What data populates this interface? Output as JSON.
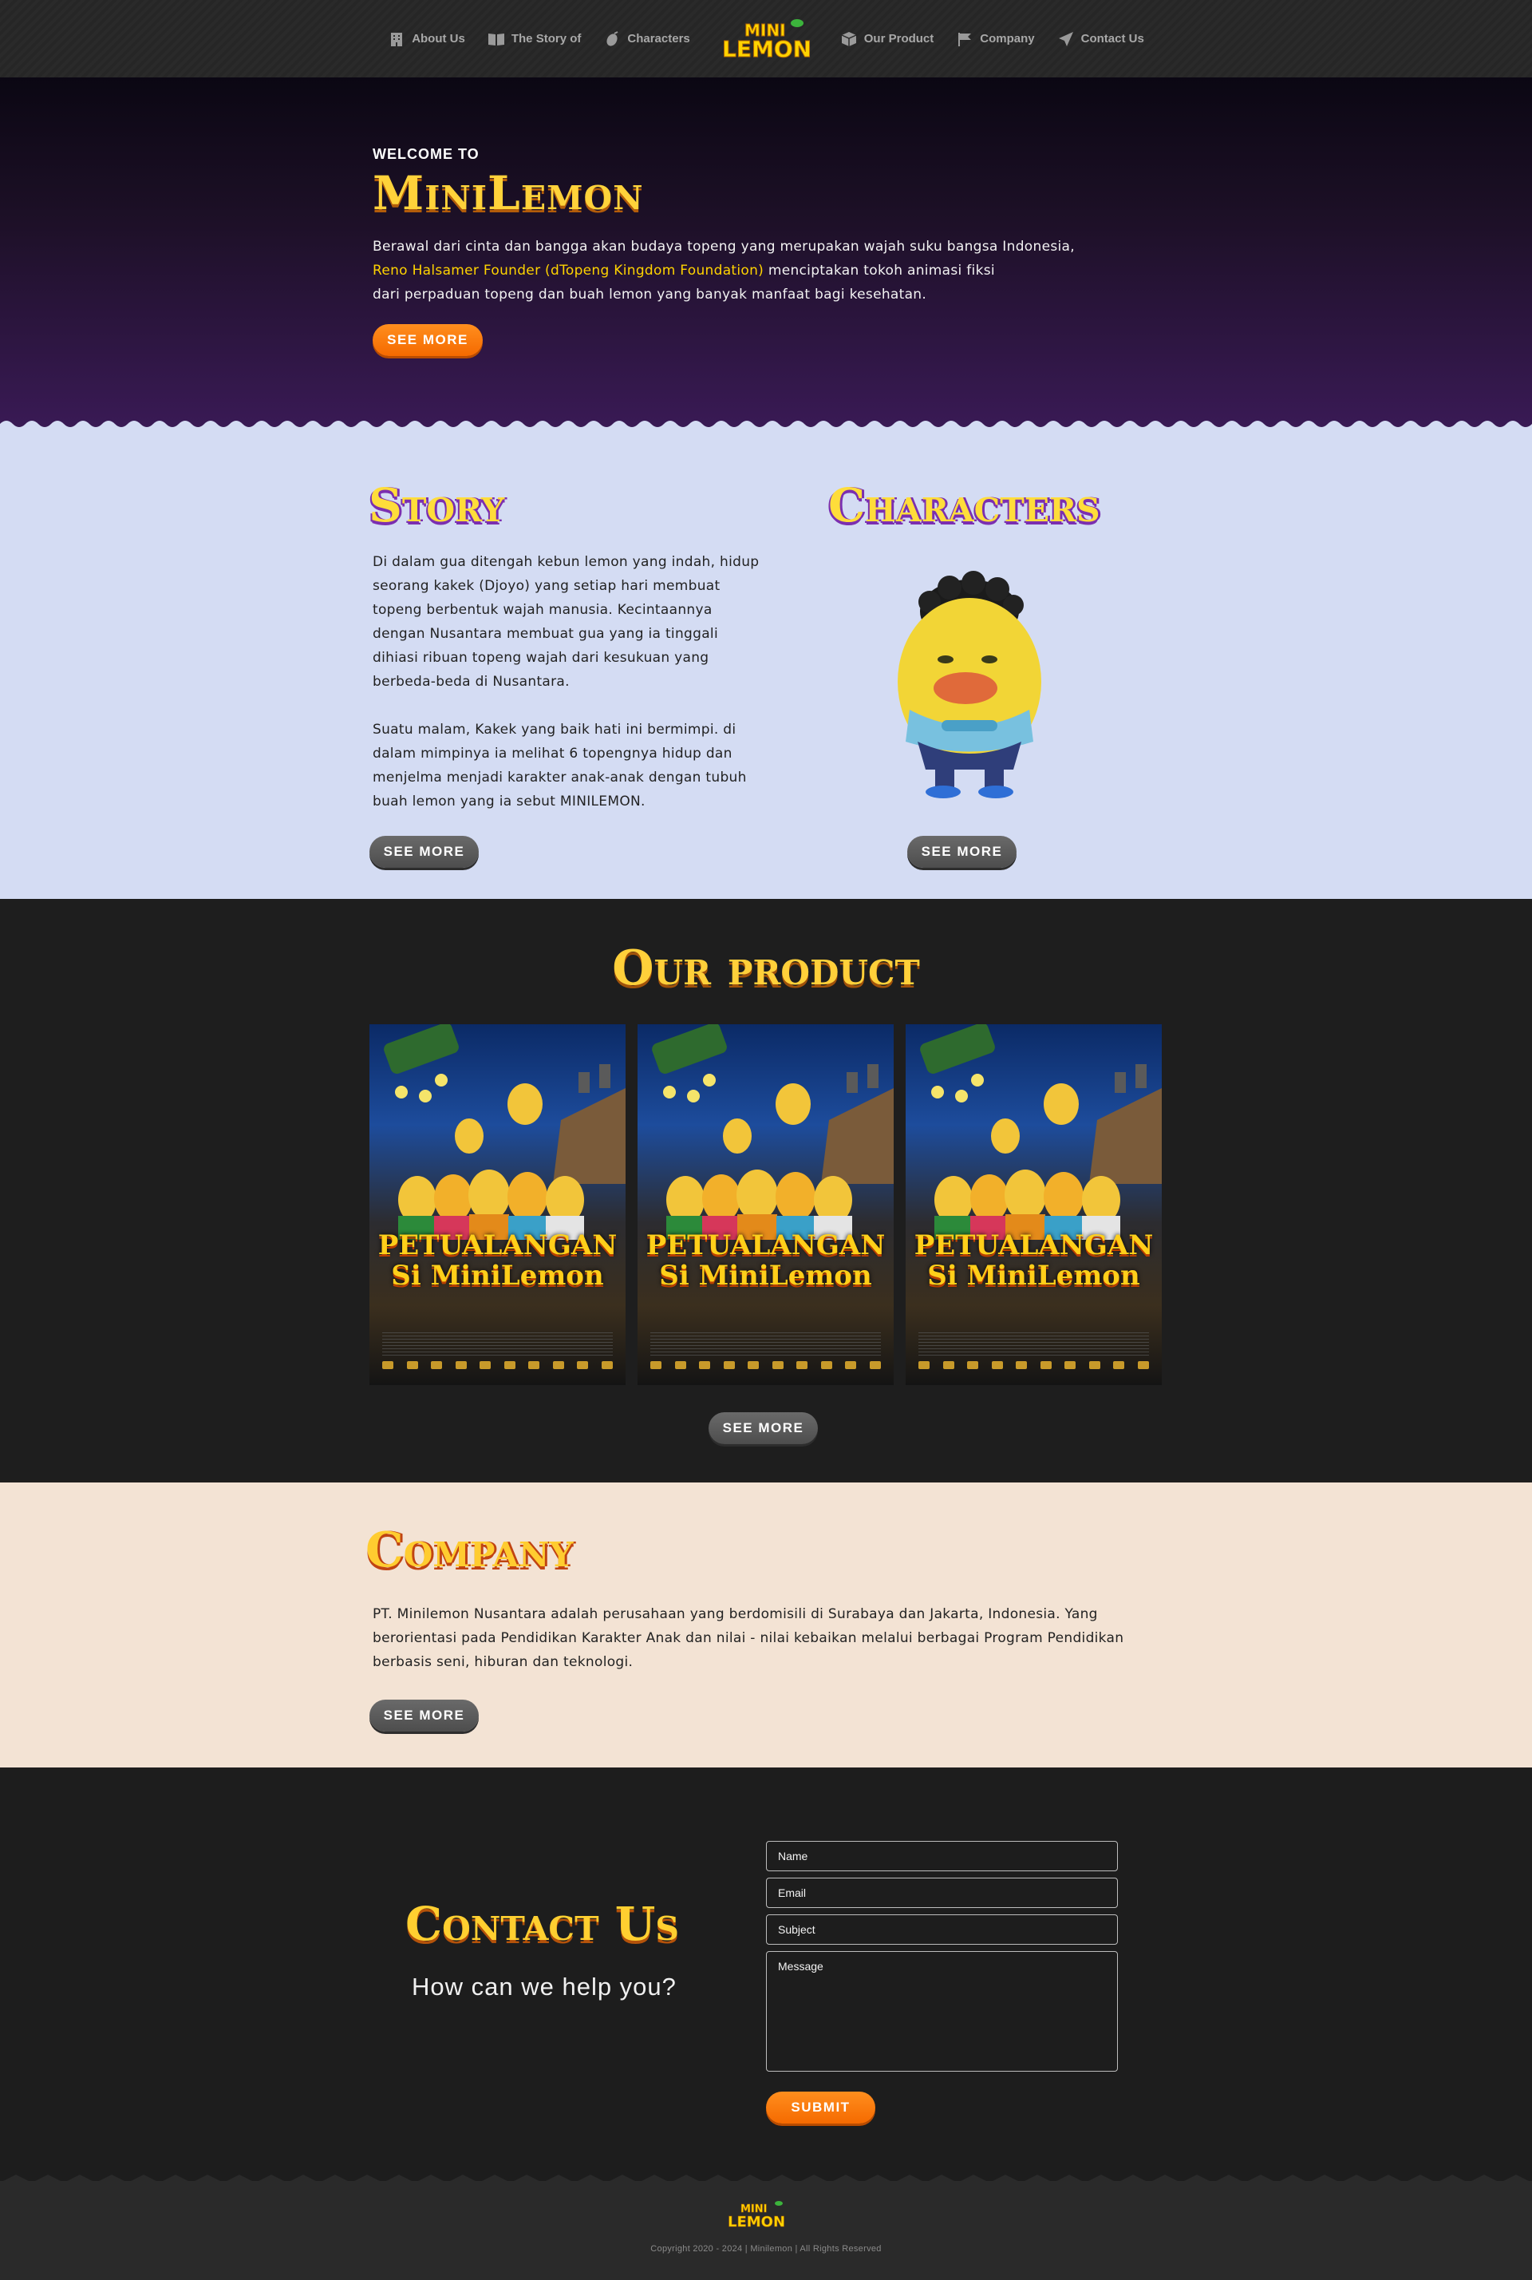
{
  "nav": {
    "left_items": [
      {
        "label": "About Us",
        "icon": "building-icon"
      },
      {
        "label": "The Story of",
        "icon": "book-icon"
      },
      {
        "label": "Characters",
        "icon": "lemon-icon"
      }
    ],
    "logo_text_top": "MINI",
    "logo_text_bottom": "LEMON",
    "right_items": [
      {
        "label": "Our Product",
        "icon": "box-icon"
      },
      {
        "label": "Company",
        "icon": "flag-icon"
      },
      {
        "label": "Contact Us",
        "icon": "paper-plane-icon"
      }
    ]
  },
  "hero": {
    "welcome": "WELCOME TO",
    "title": "MiniLemon",
    "text_line1": "Berawal dari cinta dan bangga akan budaya topeng yang merupakan wajah suku bangsa Indonesia,",
    "text_highlight": "Reno Halsamer Founder (dTopeng Kingdom Foundation)",
    "text_line2_rest": " menciptakan tokoh animasi fiksi",
    "text_line3": "dari perpaduan topeng dan buah lemon yang banyak manfaat bagi kesehatan.",
    "button": "SEE MORE"
  },
  "story": {
    "title": "Story",
    "paragraph1": "Di dalam gua ditengah kebun lemon yang indah, hidup seorang kakek (Djoyo) yang setiap hari membuat topeng berbentuk wajah manusia. Kecintaannya dengan Nusantara membuat gua yang ia tinggali dihiasi ribuan topeng wajah dari kesukuan yang berbeda-beda di Nusantara.",
    "paragraph2": "Suatu malam, Kakek yang baik hati ini bermimpi. di dalam mimpinya ia melihat 6 topengnya hidup dan menjelma menjadi karakter anak-anak dengan tubuh buah lemon yang ia sebut MINILEMON.",
    "button": "SEE MORE"
  },
  "characters": {
    "title": "Characters",
    "button": "SEE MORE"
  },
  "product": {
    "title": "Our product",
    "posters": [
      {
        "line1": "PETUALANGAN",
        "line2": "Si MiniLemon"
      },
      {
        "line1": "PETUALANGAN",
        "line2": "Si MiniLemon"
      },
      {
        "line1": "PETUALANGAN",
        "line2": "Si MiniLemon"
      }
    ],
    "button": "SEE MORE"
  },
  "company": {
    "title": "Company",
    "text": "PT. Minilemon Nusantara adalah perusahaan yang berdomisili di Surabaya dan Jakarta, Indonesia. Yang berorientasi pada Pendidikan Karakter Anak dan nilai - nilai kebaikan melalui berbagai Program Pendidikan berbasis seni, hiburan dan teknologi.",
    "button": "SEE MORE"
  },
  "contact": {
    "title": "Contact Us",
    "subtitle": "How can we help you?",
    "fields": {
      "name": "Name",
      "email": "Email",
      "subject": "Subject",
      "message": "Message"
    },
    "submit": "SUBMIT"
  },
  "footer": {
    "logo_text_top": "MINI",
    "logo_text_bottom": "LEMON",
    "copyright": "Copyright 2020 - 2024 | Minilemon | All Rights Reserved"
  },
  "colors": {
    "accent_orange": "#f56a00",
    "title_yellow": "#ffd23a",
    "hero_purple": "#3a1a56",
    "story_bg": "#d4dcf3",
    "company_bg": "#f3e3d4"
  }
}
